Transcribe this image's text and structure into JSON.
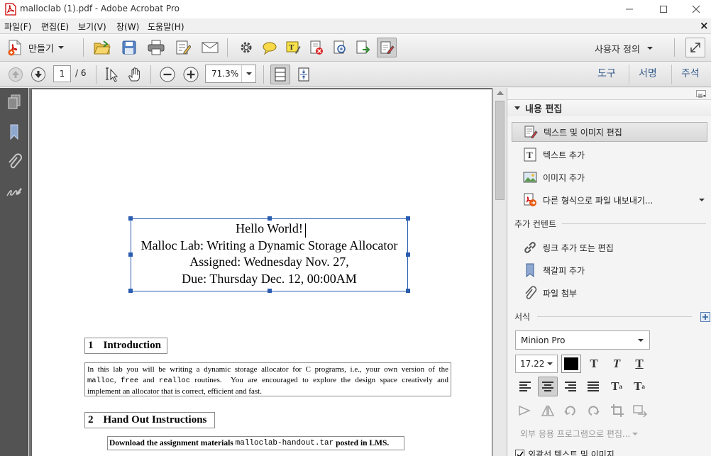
{
  "window": {
    "title": "malloclab (1).pdf - Adobe Acrobat Pro",
    "close_doc_glyph": "×"
  },
  "menu": [
    "파일(F)",
    "편집(E)",
    "보기(V)",
    "창(W)",
    "도움말(H)"
  ],
  "toolbar": {
    "create_label": "만들기",
    "custom_label": "사용자 정의"
  },
  "nav": {
    "current_page": "1",
    "total_pages": "/ 6",
    "zoom": "71.3%"
  },
  "panel_tabs": [
    "도구",
    "서명",
    "주석"
  ],
  "document": {
    "header_lines": [
      "Hello World!",
      "Malloc Lab: Writing a Dynamic Storage Allocator",
      "Assigned: Wednesday Nov. 27,",
      "Due: Thursday Dec. 12, 00:00AM"
    ],
    "section1_num": "1",
    "section1_title": "Introduction",
    "intro": {
      "l1": "In this lab you will be writing a dynamic storage allocator for C programs, i.e., your own version of the",
      "l2_code1": "malloc",
      "l2_sep1": ", ",
      "l2_code2": "free",
      "l2_and": " and ",
      "l2_code3": "realloc",
      "l2_rest": " routines.  You are encouraged to explore the design space creatively and",
      "l3": "implement an allocator that is correct, efficient and fast."
    },
    "section2_num": "2",
    "section2_title": "Hand Out Instructions",
    "download": {
      "pre": "Download the assignment materials ",
      "code": "malloclab-handout.tar",
      "post": " posted in LMS."
    }
  },
  "right_pane": {
    "section_title": "내용 편집",
    "items": [
      "텍스트 및 이미지 편집",
      "텍스트 추가",
      "이미지 추가",
      "다른 형식으로 파일 내보내기..."
    ],
    "add_content_title": "추가 컨텐트",
    "add_items": [
      "링크 추가 또는 편집",
      "책갈피 추가",
      "파일 첨부"
    ],
    "format_title": "서식",
    "font": "Minion Pro",
    "font_size": "17.22",
    "external_edit": "외부 응용 프로그램으로 편집...",
    "checkbox_label": "외곽선 텍스트 및 이미지"
  },
  "colors": {
    "accent": "#2a5db0",
    "tab_text": "#3a5f8e",
    "nav_bg": "#535353",
    "doc_bg": "#7a7a7a"
  },
  "icons": [
    "pdf-logo-icon",
    "create-pdf-icon",
    "open-folder-icon",
    "save-icon",
    "print-icon",
    "edit-form-icon",
    "email-icon",
    "gear-icon",
    "comment-icon",
    "highlight-icon",
    "redact-icon",
    "scan-icon",
    "export-icon",
    "edit-text-image-icon",
    "prev-page-icon",
    "next-page-icon",
    "select-cursor-icon",
    "hand-icon",
    "zoom-out-icon",
    "zoom-in-icon",
    "fit-page-icon",
    "fit-width-icon",
    "pages-icon",
    "bookmarks-icon",
    "attachments-icon",
    "signatures-icon",
    "text-tool-icon",
    "image-icon",
    "link-icon",
    "bookmark-icon",
    "paperclip-icon"
  ]
}
